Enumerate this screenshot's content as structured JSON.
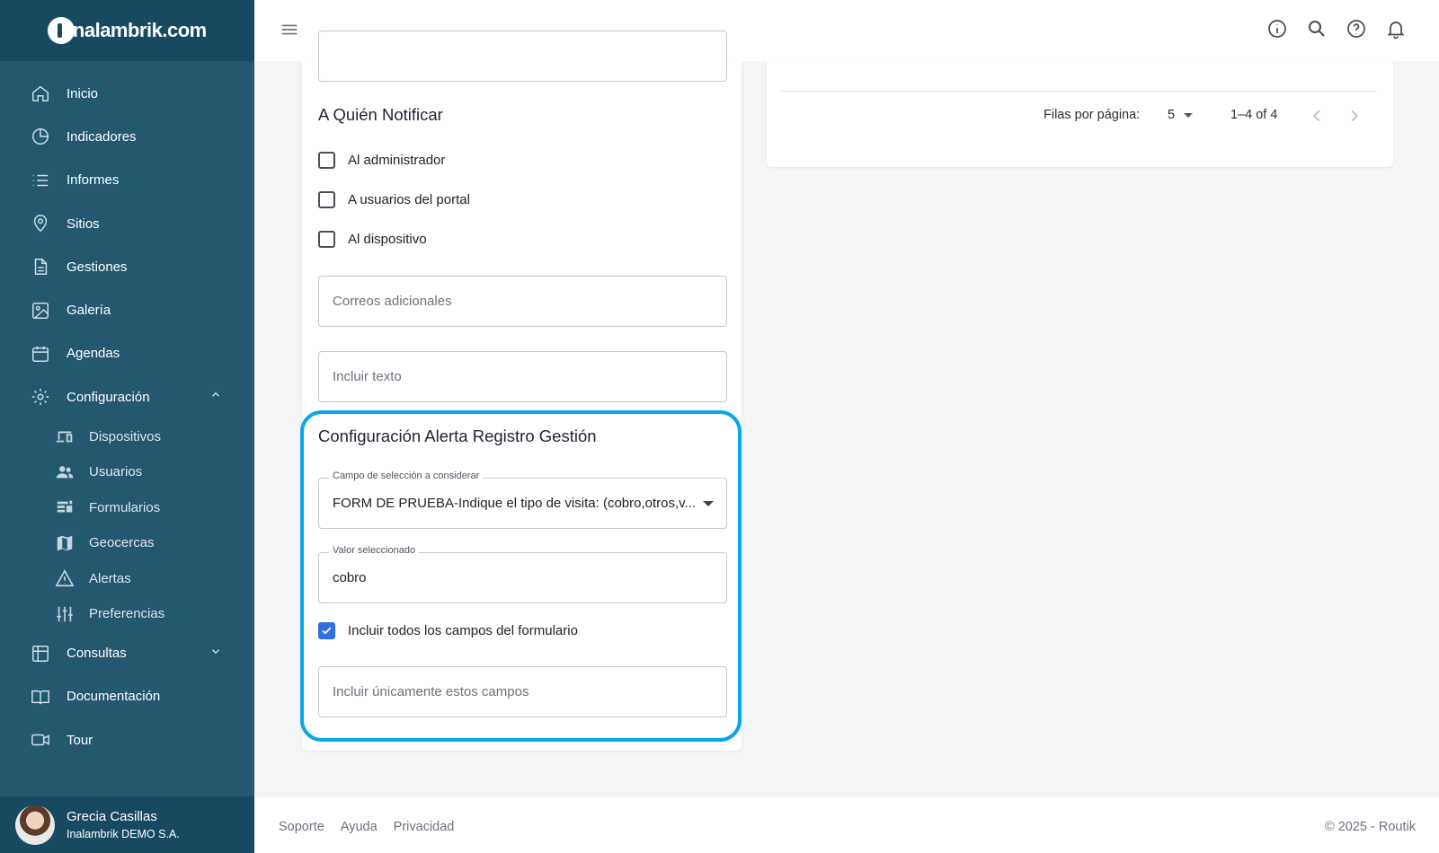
{
  "brand": {
    "name": "inalambrik.com"
  },
  "sidebar": {
    "items": [
      {
        "label": "Inicio",
        "icon": "home-icon"
      },
      {
        "label": "Indicadores",
        "icon": "pie-chart-icon"
      },
      {
        "label": "Informes",
        "icon": "list-icon"
      },
      {
        "label": "Sitios",
        "icon": "location-pin-icon"
      },
      {
        "label": "Gestiones",
        "icon": "document-icon"
      },
      {
        "label": "Galería",
        "icon": "image-icon"
      },
      {
        "label": "Agendas",
        "icon": "calendar-icon"
      },
      {
        "label": "Configuración",
        "icon": "gear-icon",
        "expanded": true
      }
    ],
    "sub_items": [
      {
        "label": "Dispositivos",
        "icon": "devices-icon"
      },
      {
        "label": "Usuarios",
        "icon": "users-icon"
      },
      {
        "label": "Formularios",
        "icon": "forms-icon"
      },
      {
        "label": "Geocercas",
        "icon": "map-icon"
      },
      {
        "label": "Alertas",
        "icon": "warning-icon"
      },
      {
        "label": "Preferencias",
        "icon": "sliders-icon"
      }
    ],
    "bottom_items": [
      {
        "label": "Consultas",
        "icon": "table-icon",
        "expanded": false
      },
      {
        "label": "Documentación",
        "icon": "book-icon"
      },
      {
        "label": "Tour",
        "icon": "video-icon"
      }
    ]
  },
  "user": {
    "name": "Grecia Casillas",
    "org": "Inalambrik DEMO S.A."
  },
  "notify": {
    "title": "A Quién Notificar",
    "options": [
      {
        "label": "Al administrador",
        "checked": false
      },
      {
        "label": "A usuarios del portal",
        "checked": false
      },
      {
        "label": "Al dispositivo",
        "checked": false
      }
    ],
    "extra_emails_placeholder": "Correos adicionales",
    "include_text_placeholder": "Incluir texto"
  },
  "alert_config": {
    "title": "Configuración Alerta Registro Gestión",
    "select_label": "Campo de selección a considerar",
    "select_value": "FORM DE PRUEBA-Indique el tipo de visita: (cobro,otros,v...",
    "value_label": "Valor seleccionado",
    "value": "cobro",
    "include_all_label": "Incluir todos los campos del formulario",
    "include_all_checked": true,
    "only_fields_placeholder": "Incluir únicamente estos campos"
  },
  "pagination": {
    "rows_label": "Filas por página:",
    "rows_value": "5",
    "range": "1–4 of 4"
  },
  "footer": {
    "links": [
      "Soporte",
      "Ayuda",
      "Privacidad"
    ],
    "copyright": "© 2025 - Routik"
  },
  "colors": {
    "sidebar": "#23586e",
    "sidebar_dark": "#174a61",
    "highlight": "#0aa6e8",
    "checkbox": "#2f6fe0"
  }
}
